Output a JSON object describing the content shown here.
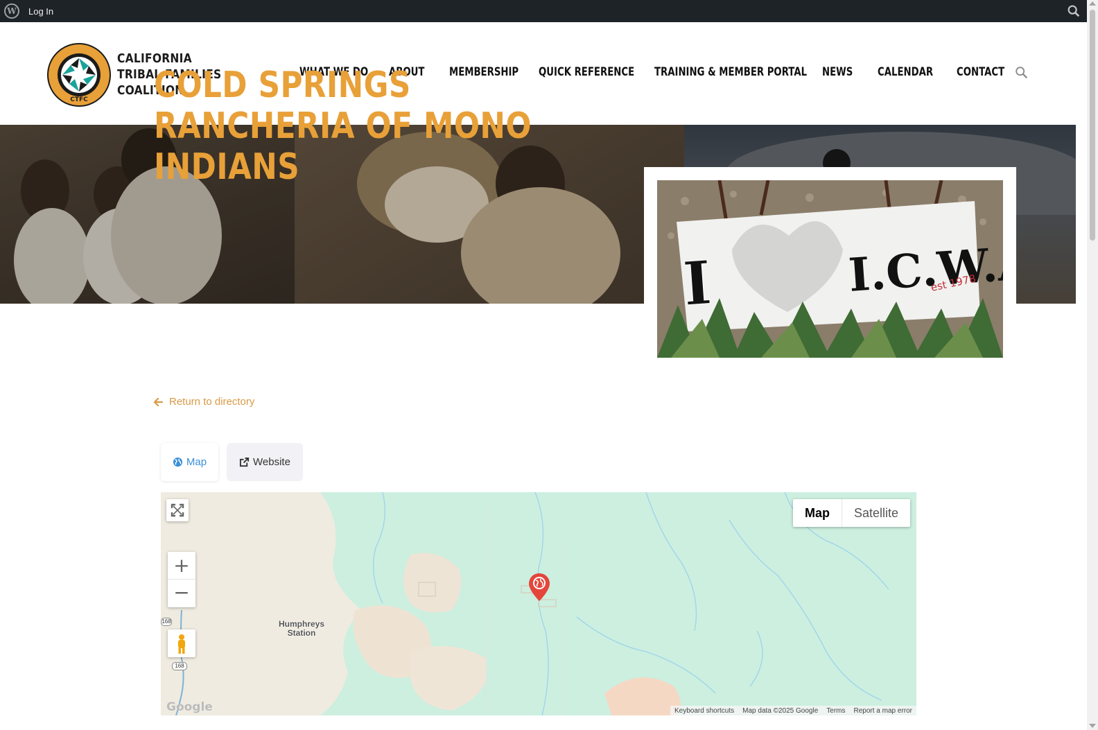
{
  "admin_bar": {
    "login_label": "Log In",
    "wp_icon": "wordpress-icon",
    "search_icon": "search-icon"
  },
  "header": {
    "logo_icon": "ctfc-logo",
    "logo_ring_text": "UNITY, ADVOCATE, STRENGTHEN",
    "logo_abbr": "CTFC",
    "brand_line1": "CALIFORNIA",
    "brand_line2": "TRIBAL FAMILIES",
    "brand_line3": "COALITION",
    "nav": [
      {
        "label": "WHAT WE DO"
      },
      {
        "label": "ABOUT"
      },
      {
        "label": "MEMBERSHIP"
      },
      {
        "label": "QUICK REFERENCE"
      },
      {
        "label": "TRAINING & MEMBER PORTAL"
      },
      {
        "label": "NEWS"
      },
      {
        "label": "CALENDAR"
      },
      {
        "label": "CONTACT"
      }
    ],
    "search_icon": "search-icon"
  },
  "hero": {
    "title": "COLD SPRINGS RANCHERIA OF MONO INDIANS",
    "feature_sign_text": "I ♥ I.C.W.A.",
    "feature_sign_est": "est 1978"
  },
  "back_link": {
    "label": "Return to directory",
    "icon": "arrow-left-icon"
  },
  "tabs": {
    "map_label": "Map",
    "map_icon": "globe-icon",
    "website_label": "Website",
    "website_icon": "external-link-icon"
  },
  "map": {
    "type_map": "Map",
    "type_satellite": "Satellite",
    "zoom_in": "+",
    "zoom_out": "−",
    "place": "Humphreys\nStation",
    "route": "168",
    "logo": "Google",
    "footer": {
      "shortcuts": "Keyboard shortcuts",
      "data": "Map data ©2025 Google",
      "terms": "Terms",
      "report": "Report a map error"
    }
  },
  "colors": {
    "accent": "#e8a038",
    "link": "#d99a45",
    "tab_active": "#3a8fd6",
    "admin_bar": "#1d2327"
  }
}
